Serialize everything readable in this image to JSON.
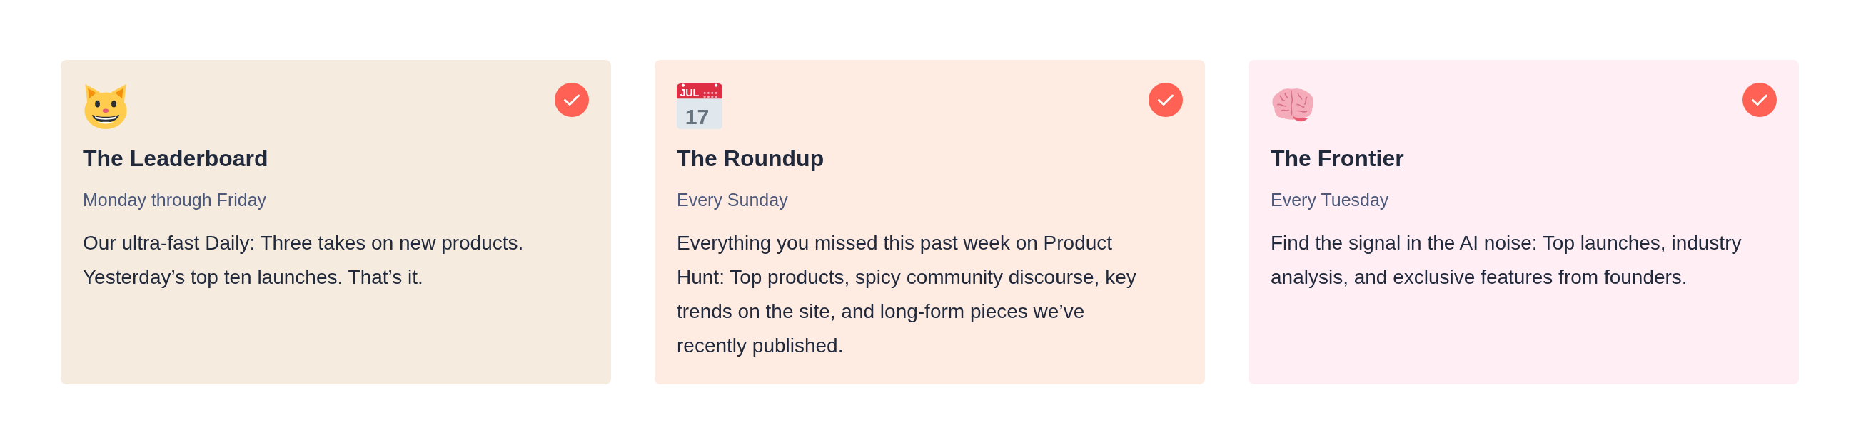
{
  "newsletters": [
    {
      "icon": {
        "kind": "cat"
      },
      "title": "The Leaderboard",
      "schedule": "Monday through Friday",
      "description": "Our ultra-fast Daily: Three takes on new products. Yesterday’s top ten launches. That’s it.",
      "color": "#f5ecdf",
      "selected": true
    },
    {
      "icon": {
        "kind": "calendar",
        "month": "JUL",
        "day": "17"
      },
      "title": "The Roundup",
      "schedule": "Every Sunday",
      "description": "Everything you missed this past week on Product Hunt: Top products, spicy community discourse, key trends on the site, and long-form pieces we’ve recently published.",
      "color": "#feebe1",
      "selected": true
    },
    {
      "icon": {
        "kind": "brain"
      },
      "title": "The Frontier",
      "schedule": "Every Tuesday",
      "description": "Find the signal in the AI noise: Top launches, industry analysis, and exclusive features from founders.",
      "color": "#ffeef3",
      "selected": true
    }
  ]
}
